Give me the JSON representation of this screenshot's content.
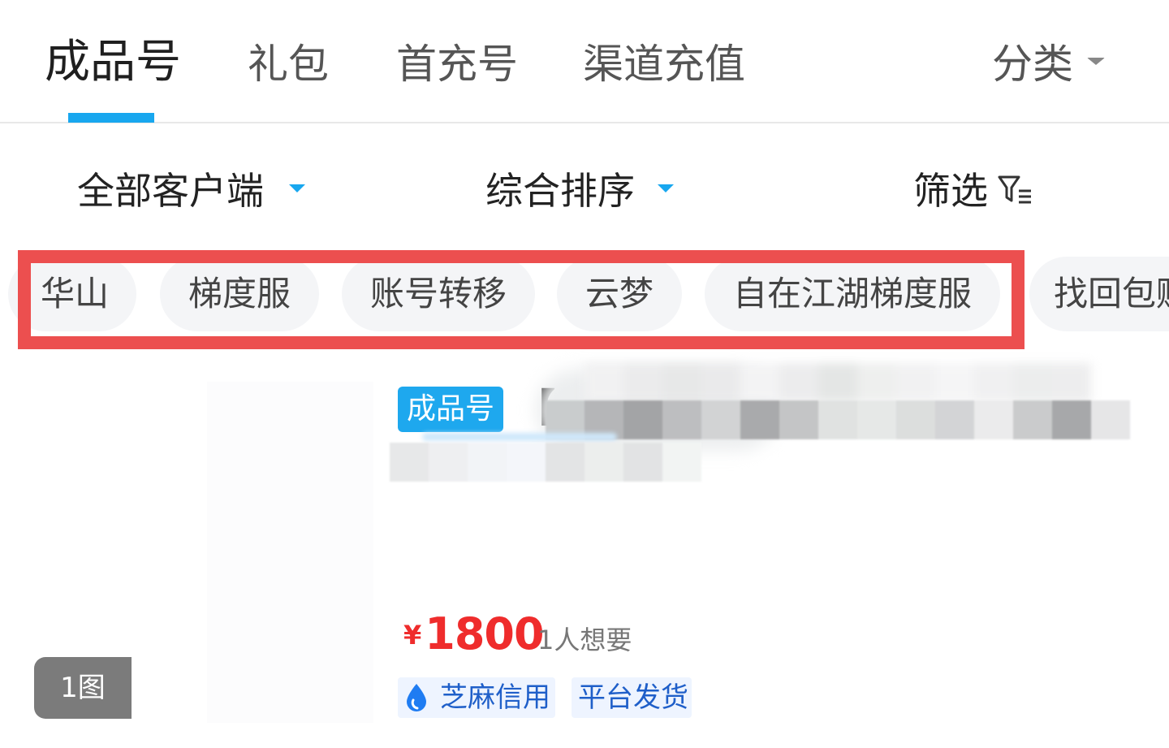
{
  "tabs": [
    {
      "label": "成品号",
      "active": true
    },
    {
      "label": "礼包",
      "active": false
    },
    {
      "label": "首充号",
      "active": false
    },
    {
      "label": "渠道充值",
      "active": false
    }
  ],
  "category_label": "分类",
  "filters": {
    "client": "全部客户端",
    "sort": "综合排序",
    "filter": "筛选"
  },
  "chips": [
    "华山",
    "梯度服",
    "账号转移",
    "云梦",
    "自在江湖梯度服",
    "找回包赔"
  ],
  "listing": {
    "image_count": "1图",
    "badge": "成品号",
    "title_prefix": "【",
    "currency": "¥",
    "price": "1800",
    "want_count": "1人想要",
    "tags": [
      "芝麻信用",
      "平台发货"
    ]
  },
  "colors": {
    "accent": "#18a7ef",
    "price": "#ef2c2c",
    "highlight_box": "#ec4f4f",
    "tag_text": "#1f5fc9"
  },
  "icons": [
    "caret-down-icon",
    "filter-icon",
    "sesame-credit-icon"
  ]
}
